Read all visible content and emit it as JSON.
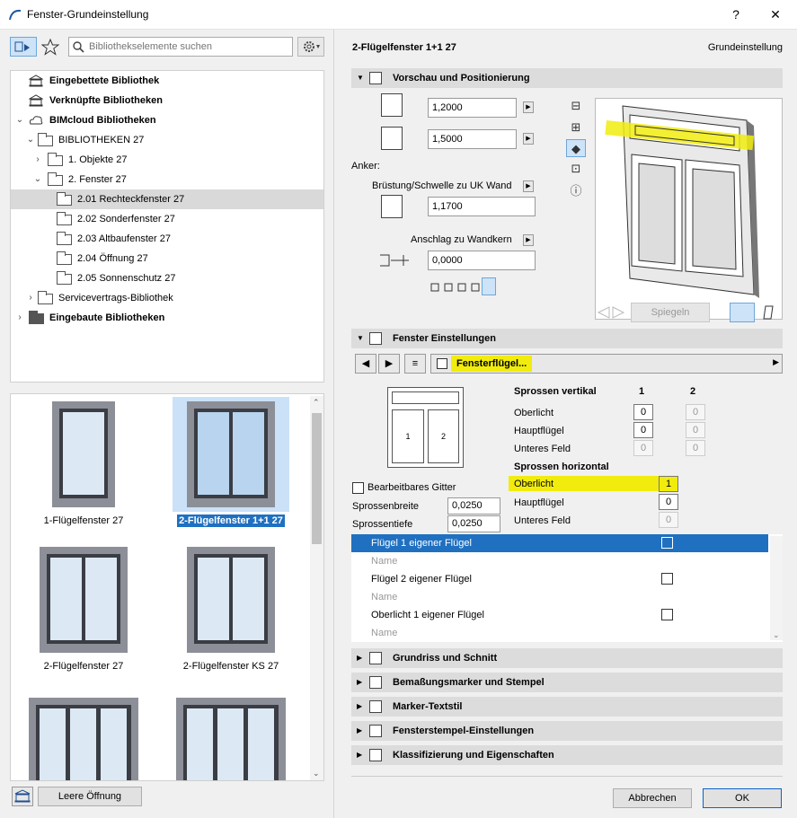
{
  "window": {
    "title": "Fenster-Grundeinstellung",
    "help": "?",
    "close": "✕"
  },
  "search": {
    "placeholder": "Bibliothekselemente suchen"
  },
  "tree": [
    {
      "label": "Eingebettete Bibliothek",
      "bold": true
    },
    {
      "label": "Verknüpfte Bibliotheken",
      "bold": true
    },
    {
      "label": "BIMcloud Bibliotheken",
      "bold": true
    },
    {
      "label": "BIBLIOTHEKEN 27",
      "bold": false
    },
    {
      "label": "1. Objekte 27",
      "bold": false
    },
    {
      "label": "2. Fenster 27",
      "bold": false
    },
    {
      "label": "2.01 Rechteckfenster 27",
      "bold": false
    },
    {
      "label": "2.02 Sonderfenster 27",
      "bold": false
    },
    {
      "label": "2.03 Altbaufenster 27",
      "bold": false
    },
    {
      "label": "2.04 Öffnung 27",
      "bold": false
    },
    {
      "label": "2.05 Sonnenschutz 27",
      "bold": false
    },
    {
      "label": "Servicevertrags-Bibliothek",
      "bold": false
    },
    {
      "label": "Eingebaute Bibliotheken",
      "bold": true
    }
  ],
  "gallery": [
    {
      "label": "1-Flügelfenster 27"
    },
    {
      "label": "2-Flügelfenster 1+1 27"
    },
    {
      "label": "2-Flügelfenster 27"
    },
    {
      "label": "2-Flügelfenster KS 27"
    }
  ],
  "left_footer": {
    "empty_opening": "Leere Öffnung"
  },
  "header": {
    "object_name": "2-Flügelfenster 1+1 27",
    "mode": "Grundeinstellung"
  },
  "sections": {
    "preview": "Vorschau und Positionierung",
    "window_settings": "Fenster Einstellungen",
    "floorplan": "Grundriss und Schnitt",
    "dimension": "Bemaßungsmarker und Stempel",
    "marker": "Marker-Textstil",
    "stamp": "Fensterstempel-Einstellungen",
    "classify": "Klassifizierung und Eigenschaften"
  },
  "positioning": {
    "width": "1,2000",
    "height": "1,5000",
    "anchor_label": "Anker:",
    "sill_label": "Brüstung/Schwelle zu UK Wand",
    "sill_value": "1,1700",
    "reveal_label": "Anschlag zu Wandkern",
    "reveal_value": "0,0000",
    "mirror_button": "Spiegeln"
  },
  "window_settings": {
    "page": "Fensterflügel...",
    "schematic": [
      "1",
      "2"
    ],
    "mullions_vertical_label": "Sprossen vertikal",
    "col1": "1",
    "col2": "2",
    "vertical_rows": [
      {
        "label": "Oberlicht",
        "v1": "0",
        "v2": "0"
      },
      {
        "label": "Hauptflügel",
        "v1": "0",
        "v2": "0"
      },
      {
        "label": "Unteres Feld",
        "v1": "0",
        "v2": "0"
      }
    ],
    "mullions_horizontal_label": "Sprossen horizontal",
    "horizontal_rows": [
      {
        "label": "Oberlicht",
        "v": "1"
      },
      {
        "label": "Hauptflügel",
        "v": "0"
      },
      {
        "label": "Unteres Feld",
        "v": "0"
      }
    ],
    "editable_grid": "Bearbeitbares Gitter",
    "bar_width_label": "Sprossenbreite",
    "bar_width": "0,0250",
    "bar_depth_label": "Sprossentiefe",
    "bar_depth": "0,0250",
    "list": [
      {
        "label": "Flügel 1 eigener Flügel"
      },
      {
        "label": "Name"
      },
      {
        "label": "Flügel 2 eigener Flügel"
      },
      {
        "label": "Name"
      },
      {
        "label": "Oberlicht 1 eigener Flügel"
      },
      {
        "label": "Name"
      }
    ]
  },
  "footer": {
    "cancel": "Abbrechen",
    "ok": "OK"
  },
  "colors": {
    "highlight": "#f1ec0e",
    "selection": "#1f70c1",
    "gallery_sel": "#cbe1f7"
  }
}
